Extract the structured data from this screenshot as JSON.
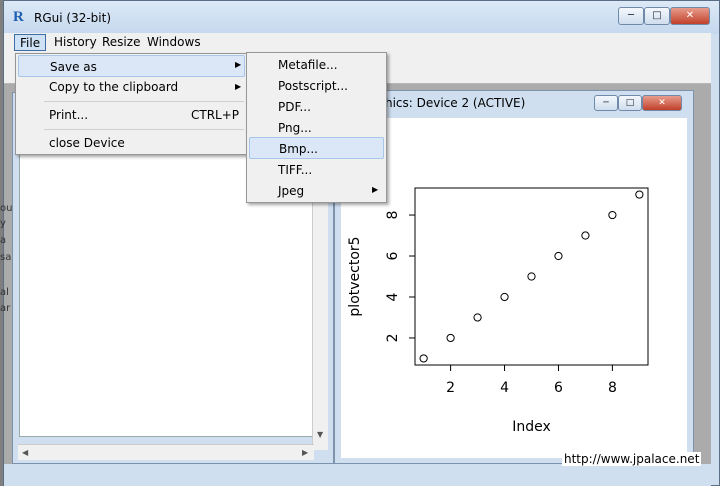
{
  "window": {
    "title": "RGui (32-bit)",
    "logo": "R",
    "controls": {
      "minimize": "─",
      "maximize": "□",
      "close": "✕"
    }
  },
  "menubar": {
    "items": [
      "File",
      "History",
      "Resize",
      "Windows"
    ]
  },
  "file_menu": {
    "items": [
      {
        "label": "Save as",
        "has_submenu": true
      },
      {
        "label": "Copy to the clipboard",
        "has_submenu": true
      },
      {
        "label": "Print...",
        "shortcut": "CTRL+P"
      },
      {
        "label": "close Device"
      }
    ]
  },
  "save_as_submenu": {
    "items": [
      "Metafile...",
      "Postscript...",
      "PDF...",
      "Png...",
      "Bmp...",
      "TIFF...",
      "Jpeg"
    ],
    "highlighted": "Bmp..."
  },
  "graphics_window": {
    "title": "aphics: Device 2 (ACTIVE)"
  },
  "chart_data": {
    "type": "scatter",
    "x": [
      1,
      2,
      3,
      4,
      5,
      6,
      7,
      8,
      9
    ],
    "y": [
      1,
      2,
      3,
      4,
      5,
      6,
      7,
      8,
      9
    ],
    "xlabel": "Index",
    "ylabel": "plotvector5",
    "xticks": [
      "2",
      "4",
      "6",
      "8"
    ],
    "yticks": [
      "2",
      "4",
      "6",
      "8"
    ],
    "xlim": [
      0.68,
      9.32
    ],
    "ylim": [
      0.68,
      9.32
    ],
    "marker": "open-circle"
  },
  "console_bleed": [
    "ou",
    "y",
    "a",
    "sa",
    "al",
    "ar"
  ],
  "watermark": "http://www.jpalace.net"
}
